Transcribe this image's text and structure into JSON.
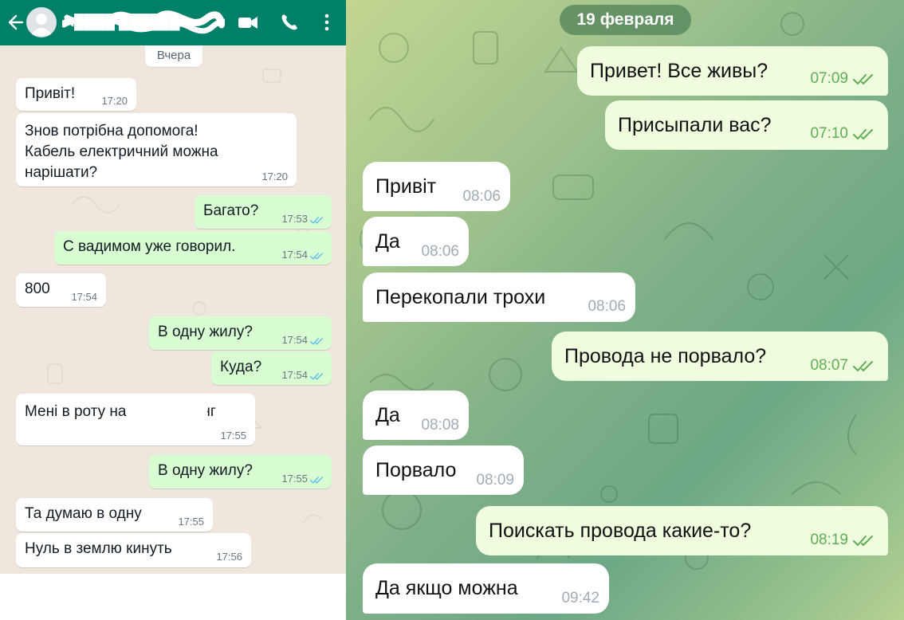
{
  "whatsapp": {
    "header": {
      "contact_name": "А████ ██████",
      "icons": [
        "back-arrow-icon",
        "avatar-icon",
        "video-call-icon",
        "phone-icon",
        "more-vert-icon"
      ]
    },
    "date_chip": "Вчера",
    "colors": {
      "header": "#008069",
      "outgoing": "#d9fdd3",
      "incoming": "#ffffff",
      "ticks": "#53bdeb"
    },
    "messages": [
      {
        "dir": "in",
        "text": "Привіт!",
        "time": "17:20"
      },
      {
        "dir": "in",
        "text": "Знов потрібна допомога!\nКабель електричний можна\nнарішати?",
        "time": "17:20"
      },
      {
        "dir": "out",
        "text": "Багато?",
        "time": "17:53"
      },
      {
        "dir": "out",
        "text": "С вадимом уже говорил.",
        "time": "17:54"
      },
      {
        "dir": "in",
        "text": "800",
        "time": "17:54"
      },
      {
        "dir": "out",
        "text": "В одну жилу?",
        "time": "17:54"
      },
      {
        "dir": "out",
        "text": "Куда?",
        "time": "17:54"
      },
      {
        "dir": "in",
        "text": "Мені в роту на           фланг",
        "time": "17:55"
      },
      {
        "dir": "out",
        "text": "В одну жилу?",
        "time": "17:55"
      },
      {
        "dir": "in",
        "text": "Та думаю в одну",
        "time": "17:55"
      },
      {
        "dir": "in",
        "text": "Нуль в землю кинуть",
        "time": "17:56"
      }
    ]
  },
  "telegram": {
    "date_chip": "19 февраля",
    "colors": {
      "outgoing": "#effdde",
      "incoming": "#ffffff",
      "date_chip": "#4c8056",
      "out_time": "#5fad56"
    },
    "messages": [
      {
        "dir": "out",
        "text": "Привет! Все живы?",
        "time": "07:09"
      },
      {
        "dir": "out",
        "text": "Присыпали вас?",
        "time": "07:10"
      },
      {
        "dir": "in",
        "text": "Привіт",
        "time": "08:06"
      },
      {
        "dir": "in",
        "text": "Да",
        "time": "08:06"
      },
      {
        "dir": "in",
        "text": "Перекопали трохи",
        "time": "08:06"
      },
      {
        "dir": "out",
        "text": "Провода не порвало?",
        "time": "08:07"
      },
      {
        "dir": "in",
        "text": "Да",
        "time": "08:08"
      },
      {
        "dir": "in",
        "text": "Порвало",
        "time": "08:09"
      },
      {
        "dir": "out",
        "text": "Поискать провода какие-то?",
        "time": "08:19"
      },
      {
        "dir": "in",
        "text": "Да якщо можна",
        "time": "09:42"
      }
    ]
  }
}
